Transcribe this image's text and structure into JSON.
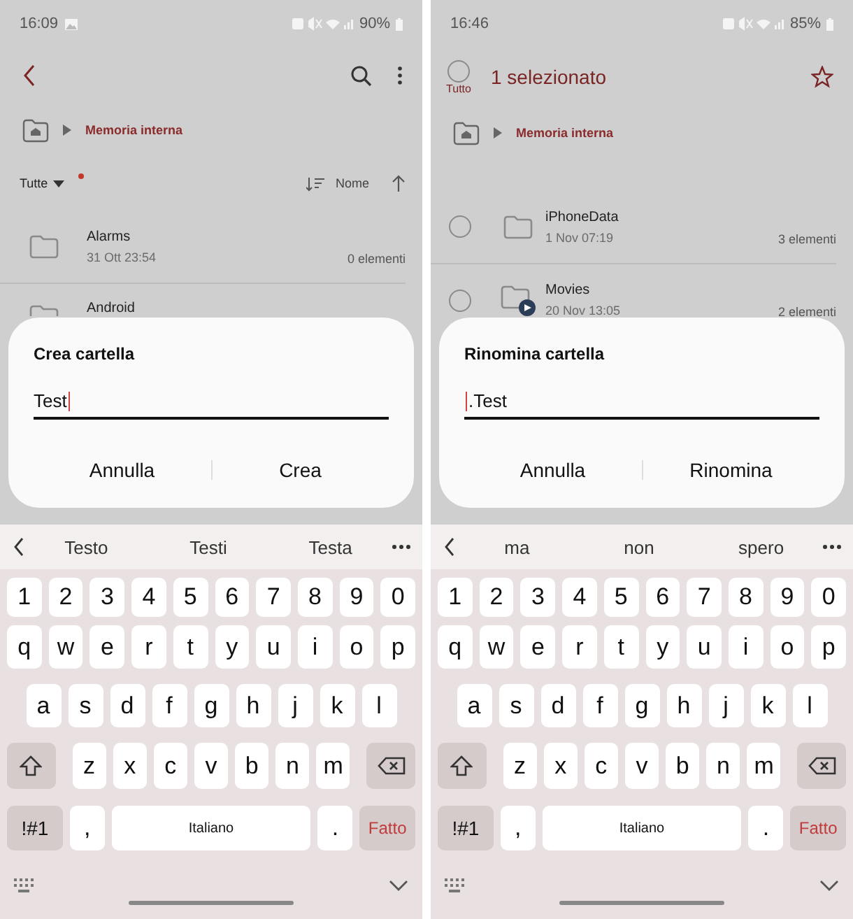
{
  "phones": [
    {
      "status_bar": {
        "time": "16:09",
        "gallery_notification": true,
        "battery": "90%"
      },
      "header": {
        "kind": "browse"
      },
      "breadcrumb": "Memoria interna",
      "filter": {
        "label": "Tutte",
        "new_dot": true,
        "sort_label": "Nome"
      },
      "list": {
        "checkboxes": false,
        "items": [
          {
            "name": "Alarms",
            "date": "31 Ott 23:54",
            "count": "0 elementi"
          },
          {
            "name": "Android"
          }
        ]
      },
      "dialog": {
        "title": "Crea cartella",
        "value": "Test",
        "buttons": [
          "Annulla",
          "Crea"
        ]
      },
      "keyboard": {
        "suggestions": [
          "Testo",
          "Testi",
          "Testa"
        ],
        "rows": [
          [
            "1",
            "2",
            "3",
            "4",
            "5",
            "6",
            "7",
            "8",
            "9",
            "0"
          ],
          [
            "q",
            "w",
            "e",
            "r",
            "t",
            "y",
            "u",
            "i",
            "o",
            "p"
          ],
          [
            "a",
            "s",
            "d",
            "f",
            "g",
            "h",
            "j",
            "k",
            "l"
          ],
          [
            "z",
            "x",
            "c",
            "v",
            "b",
            "n",
            "m"
          ]
        ],
        "bottom": [
          {
            "kind": "symbols",
            "label": "!#1"
          },
          {
            "kind": "char",
            "label": ","
          },
          {
            "kind": "space",
            "label": "Italiano"
          },
          {
            "kind": "char",
            "label": "."
          },
          {
            "kind": "done",
            "label": "Fatto"
          }
        ]
      }
    },
    {
      "status_bar": {
        "time": "16:46",
        "gallery_notification": false,
        "battery": "85%"
      },
      "header": {
        "kind": "selection",
        "select_all_label": "Tutto",
        "all_selected": false,
        "title": "1 selezionato"
      },
      "breadcrumb": "Memoria interna",
      "list": {
        "checkboxes": true,
        "items": [
          {
            "name": "iPhoneData",
            "date": "1 Nov 07:19",
            "count": "3 elementi",
            "selected": false,
            "kind": "folder"
          },
          {
            "name": "Movies",
            "date": "20 Nov 13:05",
            "count": "2 elementi",
            "selected": false,
            "kind": "video"
          }
        ]
      },
      "dialog": {
        "title": "Rinomina cartella",
        "value": ".Test",
        "buttons": [
          "Annulla",
          "Rinomina"
        ]
      },
      "keyboard": {
        "suggestions": [
          "ma",
          "non",
          "spero"
        ],
        "rows": [
          [
            "1",
            "2",
            "3",
            "4",
            "5",
            "6",
            "7",
            "8",
            "9",
            "0"
          ],
          [
            "q",
            "w",
            "e",
            "r",
            "t",
            "y",
            "u",
            "i",
            "o",
            "p"
          ],
          [
            "a",
            "s",
            "d",
            "f",
            "g",
            "h",
            "j",
            "k",
            "l"
          ],
          [
            "z",
            "x",
            "c",
            "v",
            "b",
            "n",
            "m"
          ]
        ],
        "bottom": [
          {
            "kind": "symbols",
            "label": "!#1"
          },
          {
            "kind": "char",
            "label": ","
          },
          {
            "kind": "space",
            "label": "Italiano"
          },
          {
            "kind": "char",
            "label": "."
          },
          {
            "kind": "done",
            "label": "Fatto"
          }
        ]
      }
    }
  ]
}
